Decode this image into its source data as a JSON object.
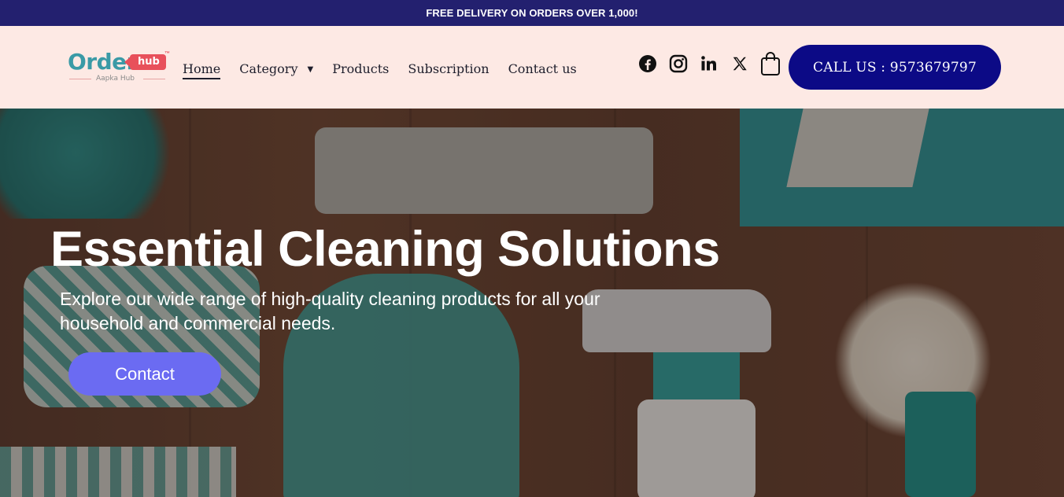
{
  "announcement": "FREE DELIVERY ON ORDERS OVER 1,000!",
  "logo": {
    "word": "Order",
    "badge": "hub",
    "tm": "™",
    "tagline": "Aapka Hub"
  },
  "nav": {
    "items": [
      {
        "label": "Home",
        "active": true
      },
      {
        "label": "Category",
        "has_dropdown": true
      },
      {
        "label": "Products"
      },
      {
        "label": "Subscription"
      },
      {
        "label": "Contact us"
      }
    ]
  },
  "social_icons": [
    "facebook-icon",
    "instagram-icon",
    "linkedin-icon",
    "x-icon",
    "shopping-bag-icon"
  ],
  "call_button": "CALL US : 9573679797",
  "hero": {
    "title": "Essential Cleaning Solutions",
    "subtitle": "Explore our wide range of high-quality cleaning products for all your household and commercial needs.",
    "button": "Contact"
  },
  "colors": {
    "topbar": "#23206f",
    "header_bg": "#fde9e4",
    "call_button": "#0c0a86",
    "hero_button": "#6b6bf2",
    "logo_teal": "#3a9aa6",
    "logo_red": "#e8505b"
  }
}
